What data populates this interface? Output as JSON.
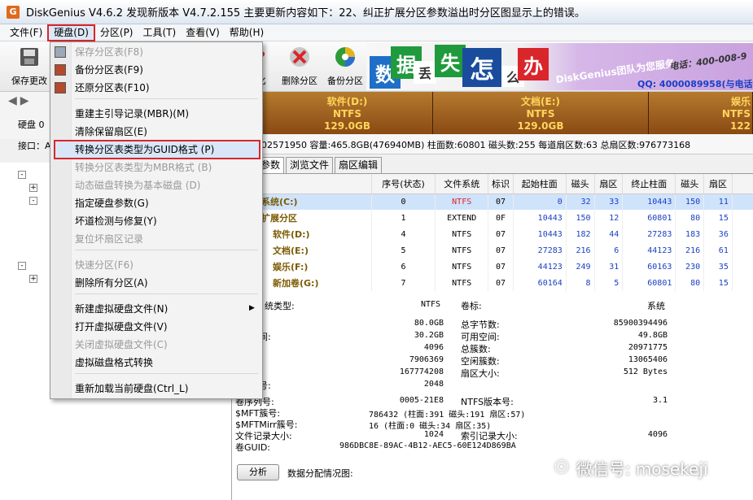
{
  "window": {
    "title": "DiskGenius V4.6.2    发现新版本 V4.7.2.155 主要更新内容如下：22、纠正扩展分区参数溢出时分区图显示上的错误。"
  },
  "menubar": {
    "items": [
      "文件(F)",
      "硬盘(D)",
      "分区(P)",
      "工具(T)",
      "查看(V)",
      "帮助(H)"
    ]
  },
  "toolbar": {
    "save_label": "保存更改",
    "format_label": "化",
    "delete_label": "删除分区",
    "backup_label": "备份分区"
  },
  "banner": {
    "chars": [
      "数",
      "据",
      "丢",
      "失",
      "怎",
      "么",
      "办"
    ],
    "brand": "DiskGenius团队为您服务",
    "phone": "电话：400-008-9",
    "qq": "QQ: 4000089958(与电话"
  },
  "leftpanel": {
    "disk_label": "硬盘 0",
    "iface_label": "接口：A"
  },
  "partition_bar": [
    {
      "name": "软件(D:)",
      "fs": "NTFS",
      "size": "129.0GB"
    },
    {
      "name": "文档(E:)",
      "fs": "NTFS",
      "size": "129.0GB"
    },
    {
      "name": "娱乐",
      "fs": "NTFS",
      "size": "122"
    }
  ],
  "info_row": "02571950  容量:465.8GB(476940MB)   柱面数:60801  磁头数:255  每道扇区数:63  总扇区数:976773168",
  "tabs": [
    "参数",
    "浏览文件",
    "扇区编辑"
  ],
  "table": {
    "headers": [
      "",
      "序号(状态)",
      "文件系统",
      "标识",
      "起始柱面",
      "磁头",
      "扇区",
      "终止柱面",
      "磁头",
      "扇区",
      "容"
    ],
    "rows": [
      {
        "name": "系统(C:)",
        "idx": "0",
        "fs": "NTFS",
        "id": "07",
        "sc": "0",
        "sh": "32",
        "ss": "33",
        "ec": "10443",
        "eh": "150",
        "es": "11",
        "cap": "80."
      },
      {
        "name": "扩展分区",
        "idx": "1",
        "fs": "EXTEND",
        "id": "0F",
        "sc": "10443",
        "sh": "150",
        "ss": "12",
        "ec": "60801",
        "eh": "80",
        "es": "15",
        "cap": "385."
      },
      {
        "name": "软件(D:)",
        "idx": "4",
        "fs": "NTFS",
        "id": "07",
        "sc": "10443",
        "sh": "182",
        "ss": "44",
        "ec": "27283",
        "eh": "183",
        "es": "36",
        "cap": "129."
      },
      {
        "name": "文档(E:)",
        "idx": "5",
        "fs": "NTFS",
        "id": "07",
        "sc": "27283",
        "sh": "216",
        "ss": "6",
        "ec": "44123",
        "eh": "216",
        "es": "61",
        "cap": "129."
      },
      {
        "name": "娱乐(F:)",
        "idx": "6",
        "fs": "NTFS",
        "id": "07",
        "sc": "44123",
        "sh": "249",
        "ss": "31",
        "ec": "60163",
        "eh": "230",
        "es": "35",
        "cap": "122."
      },
      {
        "name": "新加卷(G:)",
        "idx": "7",
        "fs": "NTFS",
        "id": "07",
        "sc": "60164",
        "sh": "8",
        "ss": "5",
        "ec": "60801",
        "eh": "80",
        "es": "15",
        "cap": "4."
      }
    ]
  },
  "details": {
    "fs_type_label": "统类型:",
    "fs_type_value": "NTFS",
    "vol_label": "卷标:",
    "vol_value": "系统",
    "left": [
      {
        "k": "量:",
        "v": "80.0GB"
      },
      {
        "k": "空间:",
        "v": "30.2GB"
      },
      {
        "k": "小:",
        "v": "4096"
      },
      {
        "k": "数:",
        "v": "7906369"
      },
      {
        "k": "数:",
        "v": "167774208"
      },
      {
        "k": "区号:",
        "v": "2048"
      }
    ],
    "right": [
      {
        "k": "总字节数:",
        "v": "85900394496"
      },
      {
        "k": "可用空间:",
        "v": "49.8GB"
      },
      {
        "k": "总簇数:",
        "v": "20971775"
      },
      {
        "k": "空闲簇数:",
        "v": "13065406"
      },
      {
        "k": "扇区大小:",
        "v": "512 Bytes"
      }
    ],
    "lower": [
      {
        "k": "卷序列号:",
        "v": "0005-21E8",
        "k2": "NTFS版本号:",
        "v2": "3.1"
      },
      {
        "k": "$MFT簇号:",
        "v": "786432 (柱面:391 磁头:191 扇区:57)",
        "k2": "",
        "v2": ""
      },
      {
        "k": "$MFTMirr簇号:",
        "v": "16 (柱面:0 磁头:34 扇区:35)",
        "k2": "",
        "v2": ""
      },
      {
        "k": "文件记录大小:",
        "v": "1024",
        "k2": "索引记录大小:",
        "v2": "4096"
      },
      {
        "k": "卷GUID:",
        "v": "986DBC8E-89AC-4B12-AEC5-60E124D869BA",
        "k2": "",
        "v2": ""
      }
    ],
    "analyze_button": "分析",
    "alloc_label": "数据分配情况图:"
  },
  "dropdown": {
    "items": [
      {
        "label": "保存分区表(F8)",
        "disabled": true
      },
      {
        "label": "备份分区表(F9)",
        "disabled": false
      },
      {
        "label": "还原分区表(F10)",
        "disabled": false
      },
      {
        "label": "重建主引导记录(MBR)(M)",
        "disabled": false
      },
      {
        "label": "清除保留扇区(E)",
        "disabled": false
      },
      {
        "label": "转换分区表类型为GUID格式 (P)",
        "disabled": false
      },
      {
        "label": "转换分区表类型为MBR格式 (B)",
        "disabled": true
      },
      {
        "label": "动态磁盘转换为基本磁盘 (D)",
        "disabled": true
      },
      {
        "label": "指定硬盘参数(G)",
        "disabled": false
      },
      {
        "label": "坏道检测与修复(Y)",
        "disabled": false
      },
      {
        "label": "复位坏扇区记录",
        "disabled": true
      },
      {
        "label": "快速分区(F6)",
        "disabled": true
      },
      {
        "label": "删除所有分区(A)",
        "disabled": false
      },
      {
        "label": "新建虚拟硬盘文件(N)",
        "disabled": false
      },
      {
        "label": "打开虚拟硬盘文件(V)",
        "disabled": false
      },
      {
        "label": "关闭虚拟硬盘文件(C)",
        "disabled": true
      },
      {
        "label": "虚拟磁盘格式转换",
        "disabled": false
      },
      {
        "label": "重新加载当前硬盘(Ctrl_L)",
        "disabled": false
      }
    ]
  },
  "watermark": {
    "text": "微信号: mosekeji"
  },
  "colors": {
    "highlight_border": "#d9262b",
    "partition_bar": "#8a4a14",
    "partition_text": "#ffd65a",
    "number_blue": "#1a3fc4"
  }
}
